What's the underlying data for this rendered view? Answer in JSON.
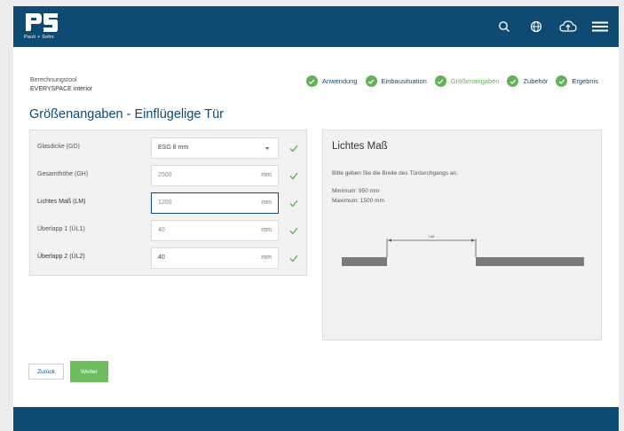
{
  "header": {
    "logo_text": "Pauli + Sohn",
    "icons": [
      "search-icon",
      "globe-icon",
      "cloud-upload-icon",
      "menu-icon"
    ]
  },
  "breadcrumb": {
    "line1": "Berechnungstool",
    "line2": "EVERYSPACE interior"
  },
  "steps": [
    {
      "label": "Anwendung",
      "done": true
    },
    {
      "label": "Einbausituation",
      "done": true
    },
    {
      "label": "Größenangaben",
      "done": true
    },
    {
      "label": "Zubehör",
      "done": true
    },
    {
      "label": "Ergebnis",
      "done": true
    }
  ],
  "page_title": "Größenangaben - Einflügelige Tür",
  "form": {
    "rows": [
      {
        "label": "Glasdicke (GD)",
        "value": "ESG 8 mm",
        "unit": "",
        "type": "select"
      },
      {
        "label": "Gesamthöhe (GH)",
        "value": "2500",
        "unit": "mm",
        "type": "input"
      },
      {
        "label": "Lichtes Maß (LM)",
        "value": "1200",
        "unit": "mm",
        "type": "input",
        "active": true
      },
      {
        "label": "Überlapp 1 (ÜL1)",
        "value": "40",
        "unit": "mm",
        "type": "input"
      },
      {
        "label": "Überlapp 2 (ÜL2)",
        "value": "40",
        "unit": "mm",
        "type": "input"
      }
    ]
  },
  "info": {
    "title": "Lichtes Maß",
    "text": "Bitte geben Sie die Breite des Türdurchgangs an.",
    "min": "Minimum: 950 mm",
    "max": "Maximum: 1500 mm",
    "diagram_label": "LM"
  },
  "buttons": {
    "back": "Zurück",
    "next": "Weiter"
  },
  "colors": {
    "brand": "#0f4a73",
    "success": "#63b25a",
    "next_button": "#6ebd5f"
  }
}
